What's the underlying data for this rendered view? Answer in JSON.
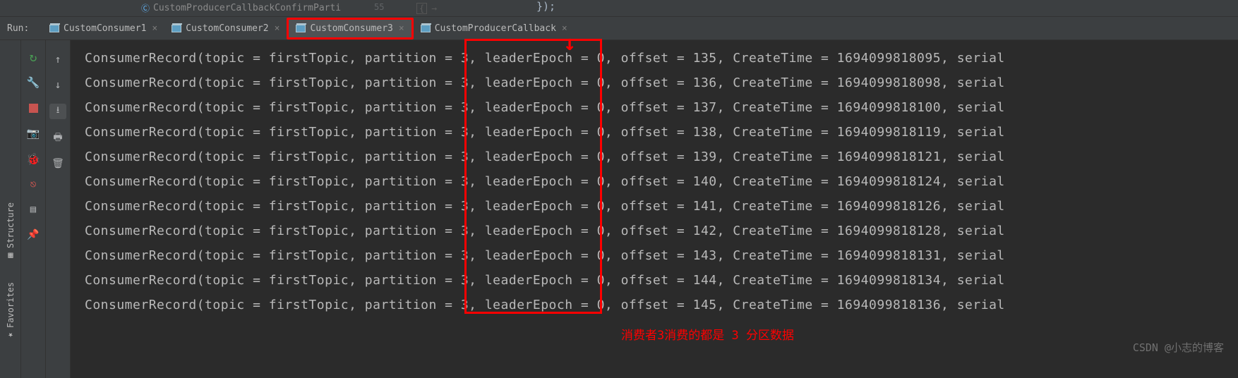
{
  "top_file": {
    "name": "CustomProducerCallbackConfirmParti",
    "line_number": "55"
  },
  "top_snippet": {
    "brace1": "{",
    "arrow": "→",
    "paren": "});"
  },
  "run_label": "Run:",
  "tabs": [
    {
      "label": "CustomConsumer1",
      "active": false
    },
    {
      "label": "CustomConsumer2",
      "active": false
    },
    {
      "label": "CustomConsumer3",
      "active": true
    },
    {
      "label": "CustomProducerCallback",
      "active": false
    }
  ],
  "sidebar": {
    "structure": "Structure",
    "favorites": "Favorites"
  },
  "console_lines": [
    "ConsumerRecord(topic = firstTopic, partition = 3, leaderEpoch = 0, offset = 135, CreateTime = 1694099818095, serial",
    "ConsumerRecord(topic = firstTopic, partition = 3, leaderEpoch = 0, offset = 136, CreateTime = 1694099818098, serial",
    "ConsumerRecord(topic = firstTopic, partition = 3, leaderEpoch = 0, offset = 137, CreateTime = 1694099818100, serial",
    "ConsumerRecord(topic = firstTopic, partition = 3, leaderEpoch = 0, offset = 138, CreateTime = 1694099818119, serial",
    "ConsumerRecord(topic = firstTopic, partition = 3, leaderEpoch = 0, offset = 139, CreateTime = 1694099818121, serial",
    "ConsumerRecord(topic = firstTopic, partition = 3, leaderEpoch = 0, offset = 140, CreateTime = 1694099818124, serial",
    "ConsumerRecord(topic = firstTopic, partition = 3, leaderEpoch = 0, offset = 141, CreateTime = 1694099818126, serial",
    "ConsumerRecord(topic = firstTopic, partition = 3, leaderEpoch = 0, offset = 142, CreateTime = 1694099818128, serial",
    "ConsumerRecord(topic = firstTopic, partition = 3, leaderEpoch = 0, offset = 143, CreateTime = 1694099818131, serial",
    "ConsumerRecord(topic = firstTopic, partition = 3, leaderEpoch = 0, offset = 144, CreateTime = 1694099818134, serial",
    "ConsumerRecord(topic = firstTopic, partition = 3, leaderEpoch = 0, offset = 145, CreateTime = 1694099818136, serial"
  ],
  "annotation": "消费者3消费的都是 3 分区数据",
  "watermark": "CSDN @小志的博客"
}
